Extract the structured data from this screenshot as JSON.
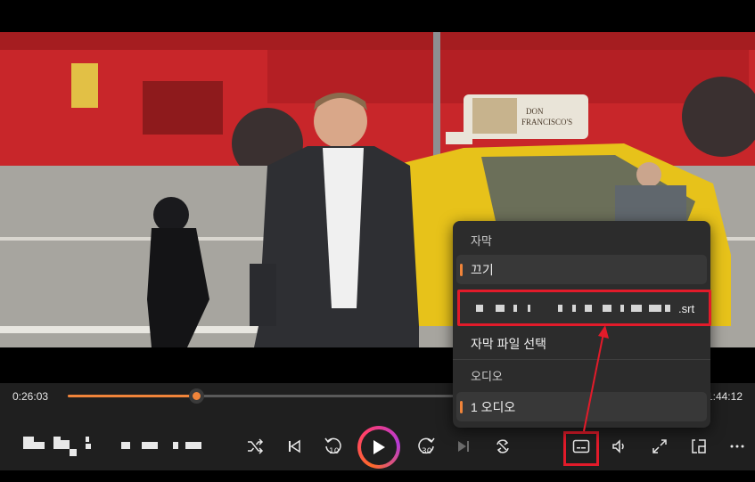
{
  "player": {
    "current_time": "0:26:03",
    "total_time": "1:44:12",
    "progress": 0.202,
    "accent_color": "#f0843a",
    "highlight_color": "#e21b2a"
  },
  "controls": [
    {
      "name": "shuffle-icon",
      "role": "shuffle"
    },
    {
      "name": "previous-icon",
      "role": "previous"
    },
    {
      "name": "rewind-10-icon",
      "role": "rewind",
      "label": "10"
    },
    {
      "name": "play-icon",
      "role": "play"
    },
    {
      "name": "forward-30-icon",
      "role": "forward",
      "label": "30"
    },
    {
      "name": "next-icon",
      "role": "next"
    },
    {
      "name": "repeat-icon",
      "role": "repeat"
    },
    {
      "name": "subtitles-icon",
      "role": "subtitles"
    },
    {
      "name": "volume-icon",
      "role": "volume"
    },
    {
      "name": "fullscreen-icon",
      "role": "fullscreen"
    },
    {
      "name": "miniplayer-icon",
      "role": "miniplayer"
    },
    {
      "name": "more-icon",
      "role": "more"
    }
  ],
  "menu": {
    "subtitles_header": "자막",
    "subtitle_off": "끄기",
    "subtitle_file_ext": ".srt",
    "choose_file": "자막 파일 선택",
    "audio_header": "오디오",
    "audio_track": "1 오디오"
  }
}
